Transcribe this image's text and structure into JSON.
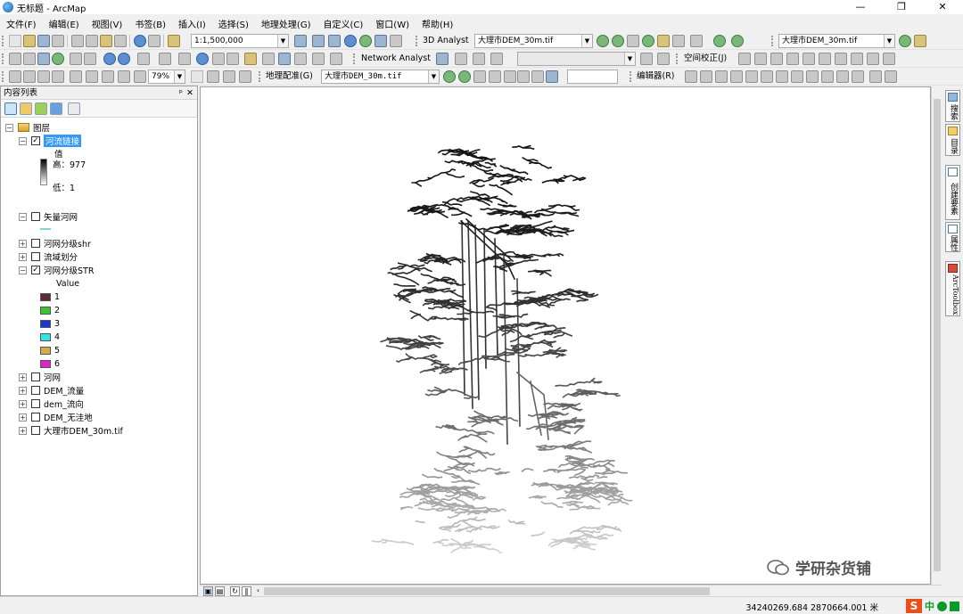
{
  "window": {
    "title": "无标题 - ArcMap",
    "min": "—",
    "max": "❐",
    "close": "✕"
  },
  "menu": [
    "文件(F)",
    "编辑(E)",
    "视图(V)",
    "书签(B)",
    "插入(I)",
    "选择(S)",
    "地理处理(G)",
    "自定义(C)",
    "窗口(W)",
    "帮助(H)"
  ],
  "toolbar1": {
    "scale": "1:1,500,000",
    "analyst_3d": "3D Analyst",
    "layer_3d": "大理市DEM_30m.tif",
    "layer_right": "大理市DEM_30m.tif"
  },
  "toolbar2": {
    "network_analyst": "Network Analyst",
    "spatial_adjust": "空间校正(J)"
  },
  "toolbar3": {
    "zoom": "79%",
    "georef": "地理配准(G)",
    "georef_layer": "大理市DEM_30m.tif",
    "editor": "编辑器(R)"
  },
  "toc": {
    "title": "内容列表",
    "pin": "ᵖ",
    "close": "✕",
    "root": "图层",
    "layer1": {
      "name": "河流链接",
      "value_label": "值",
      "high": "高：977",
      "low": "低：1"
    },
    "layer2": {
      "name": "矢量河网"
    },
    "layer3": {
      "name": "河网分级shr"
    },
    "layer4": {
      "name": "流域划分"
    },
    "layer5": {
      "name": "河网分级STR",
      "value_label": "Value",
      "classes": [
        {
          "label": "1",
          "color": "#5c2a33"
        },
        {
          "label": "2",
          "color": "#3cc332"
        },
        {
          "label": "3",
          "color": "#1c37cf"
        },
        {
          "label": "4",
          "color": "#2fe6e8"
        },
        {
          "label": "5",
          "color": "#d4ad4a"
        },
        {
          "label": "6",
          "color": "#e023c5"
        }
      ]
    },
    "layer6": {
      "name": "河网"
    },
    "layer7": {
      "name": "DEM_流量"
    },
    "layer8": {
      "name": "dem_流向"
    },
    "layer9": {
      "name": "DEM_无洼地"
    },
    "layer10": {
      "name": "大理市DEM_30m.tif"
    }
  },
  "dock": [
    "搜索",
    "目录",
    "创建要素",
    "属性",
    "ArcToolbox"
  ],
  "status": {
    "coords": "34240269.684  2870664.001 米"
  },
  "ime": {
    "s": "S",
    "zh": "中"
  },
  "watermark": "学研杂货铺"
}
